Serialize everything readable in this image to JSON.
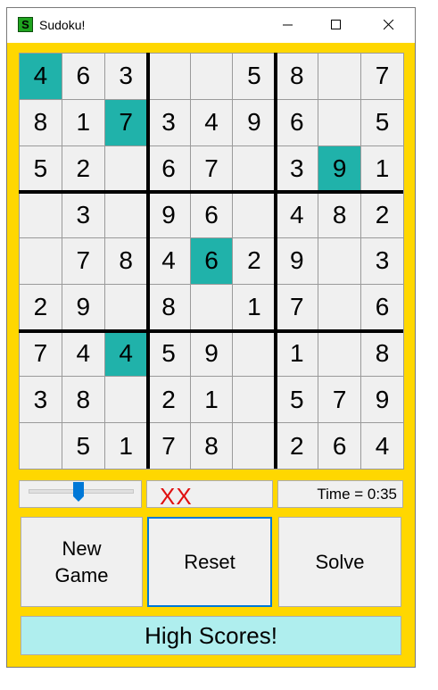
{
  "window": {
    "title": "Sudoku!",
    "app_icon_letter": "S"
  },
  "board": {
    "rows": [
      [
        "4",
        "6",
        "3",
        "",
        "",
        "5",
        "8",
        "",
        "7"
      ],
      [
        "8",
        "1",
        "7",
        "3",
        "4",
        "9",
        "6",
        "",
        "5"
      ],
      [
        "5",
        "2",
        "",
        "6",
        "7",
        "",
        "3",
        "9",
        "1"
      ],
      [
        "",
        "3",
        "",
        "9",
        "6",
        "",
        "4",
        "8",
        "2"
      ],
      [
        "",
        "7",
        "8",
        "4",
        "6",
        "2",
        "9",
        "",
        "3"
      ],
      [
        "2",
        "9",
        "",
        "8",
        "",
        "1",
        "7",
        "",
        "6"
      ],
      [
        "7",
        "4",
        "4",
        "5",
        "9",
        "",
        "1",
        "",
        "8"
      ],
      [
        "3",
        "8",
        "",
        "2",
        "1",
        "",
        "5",
        "7",
        "9"
      ],
      [
        "",
        "5",
        "1",
        "7",
        "8",
        "",
        "2",
        "6",
        "4"
      ]
    ],
    "highlighted": [
      [
        0,
        0
      ],
      [
        1,
        2
      ],
      [
        2,
        7
      ],
      [
        4,
        4
      ],
      [
        6,
        2
      ]
    ],
    "highlight_color": "#20b2aa"
  },
  "status": {
    "difficulty_slider_value": 0.5,
    "mistakes": "XX",
    "timer": "Time = 0:35"
  },
  "buttons": {
    "new_game": "New\nGame",
    "reset": "Reset",
    "solve": "Solve",
    "high_scores": "High Scores!"
  },
  "colors": {
    "background": "#ffd700",
    "mistake": "#e01010",
    "high_scores_bg": "#afeeee"
  }
}
